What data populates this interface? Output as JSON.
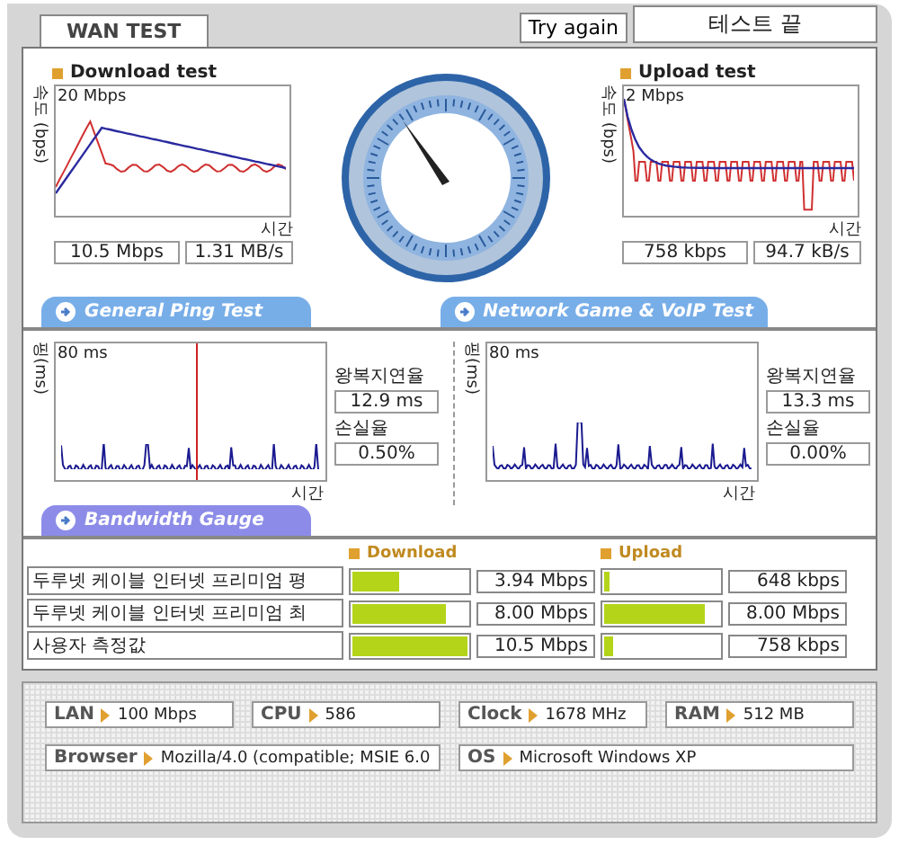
{
  "tabs": [
    {
      "label": "WAN TEST",
      "selected": true
    }
  ],
  "try_again_button": "Try again",
  "status": "테스트 끝",
  "speed_tests": [
    {
      "title": "Download test",
      "y_axis": "속도 (bps)",
      "max_label": "20 Mbps",
      "x_axis": "시간",
      "readouts": [
        "10.5 Mbps",
        "1.31 MB/s"
      ]
    },
    {
      "title": "Upload test",
      "y_axis": "속도 (bps)",
      "max_label": "2 Mbps",
      "x_axis": "시간",
      "readouts": [
        "758 kbps",
        "94.7 kB/s"
      ]
    }
  ],
  "ping_tests": [
    {
      "header": "General Ping Test",
      "y_axis": "핑(ms)",
      "max_label": "80 ms",
      "x_axis": "시간",
      "latency_label": "왕복지연율",
      "latency": "12.9 ms",
      "loss_label": "손실율",
      "loss": "0.50%"
    },
    {
      "header": "Network Game & VoIP Test",
      "y_axis": "핑(ms)",
      "max_label": "80 ms",
      "x_axis": "시간",
      "latency_label": "왕복지연율",
      "latency": "13.3 ms",
      "loss_label": "손실율",
      "loss": "0.00%"
    }
  ],
  "bandwidth": {
    "header": "Bandwidth Gauge",
    "download_label": "Download",
    "upload_label": "Upload",
    "rows": [
      {
        "name": "두루넷 케이블 인터넷 프리미엄 평",
        "download": {
          "level": 0.4,
          "reading": "3.94 Mbps"
        },
        "upload": {
          "level": 0.04,
          "reading": "648 kbps"
        }
      },
      {
        "name": "두루넷 케이블 인터넷 프리미엄 최",
        "download": {
          "level": 0.82,
          "reading": "8.00 Mbps"
        },
        "upload": {
          "level": 0.88,
          "reading": "8.00 Mbps"
        }
      },
      {
        "name": "사용자 측정값",
        "download": {
          "level": 1,
          "reading": "10.5 Mbps"
        },
        "upload": {
          "level": 0.08,
          "reading": "758 kbps"
        }
      }
    ]
  },
  "system_info": [
    [
      {
        "label": "LAN",
        "value": "100 Mbps"
      },
      {
        "label": "CPU",
        "value": "586"
      },
      {
        "label": "Clock",
        "value": "1678 MHz"
      },
      {
        "label": "RAM",
        "value": "512 MB"
      }
    ],
    [
      {
        "label": "Browser",
        "value": "Mozilla/4.0 (compatible; MSIE 6.0"
      },
      {
        "label": "OS",
        "value": "Microsoft Windows XP"
      }
    ]
  ]
}
